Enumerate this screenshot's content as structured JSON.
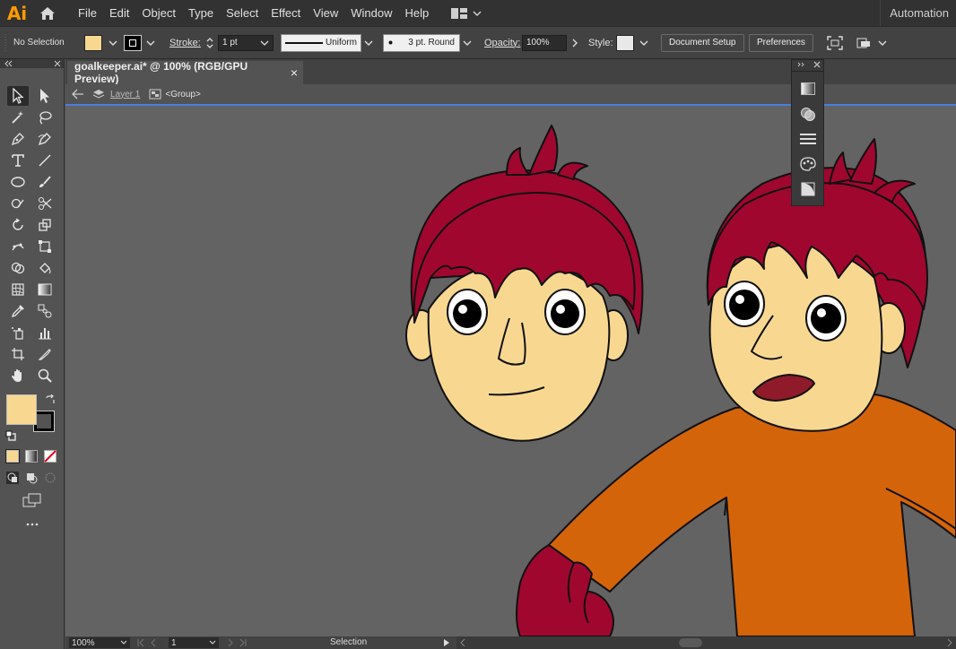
{
  "app": {
    "logo": "Ai",
    "workspace_right": "Automation"
  },
  "menu": [
    "File",
    "Edit",
    "Object",
    "Type",
    "Select",
    "Effect",
    "View",
    "Window",
    "Help"
  ],
  "control": {
    "selection": "No Selection",
    "stroke_label": "Stroke:",
    "stroke_weight": "1 pt",
    "profile": "Uniform",
    "brush": "3 pt. Round",
    "opacity_label": "Opacity:",
    "opacity_value": "100%",
    "style_label": "Style:",
    "document_setup": "Document Setup",
    "preferences": "Preferences"
  },
  "document": {
    "tab_title": "goalkeeper.ai* @ 100% (RGB/GPU Preview)",
    "close": "×",
    "layer": "Layer 1",
    "group": "<Group>"
  },
  "status": {
    "zoom": "100%",
    "artboard": "1",
    "tool": "Selection"
  },
  "colors": {
    "fill": "#f8d891",
    "stroke": "#000000",
    "hair": "#a0072e",
    "skin": "#f8d891",
    "shirt": "#d4640a",
    "canvas": "#636363"
  }
}
